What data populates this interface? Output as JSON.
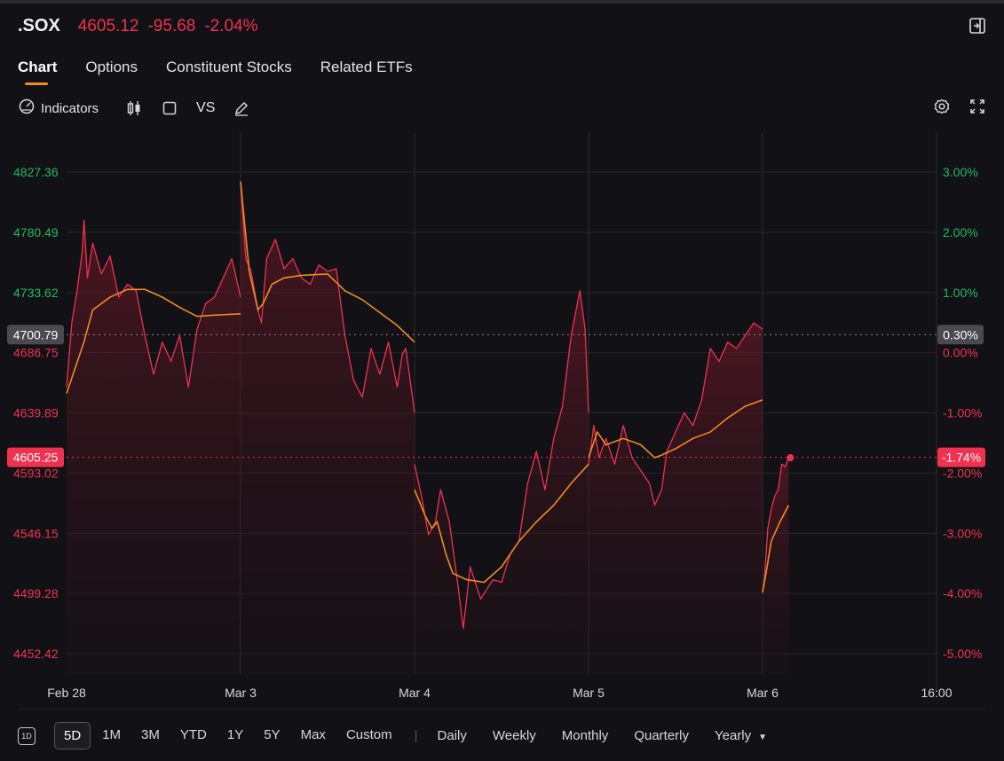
{
  "header": {
    "symbol": ".SOX",
    "price": "4605.12",
    "change": "-95.68",
    "change_pct": "-2.04%"
  },
  "tabs": [
    {
      "label": "Chart",
      "active": true
    },
    {
      "label": "Options"
    },
    {
      "label": "Constituent Stocks"
    },
    {
      "label": "Related ETFs"
    }
  ],
  "toolbar": {
    "indicators_label": "Indicators",
    "vs_label": "VS"
  },
  "icons": {
    "collapse": "collapse-panel-icon",
    "indicators": "gauge-icon",
    "candles": "candlestick-icon",
    "square": "square-icon",
    "draw": "pencil-icon",
    "settings": "gear-icon",
    "fullscreen": "expand-icon"
  },
  "colors": {
    "down": "#f0314f",
    "up": "#22b865",
    "avg_line": "#f08a24",
    "background": "#121216"
  },
  "chart_data": {
    "type": "line",
    "title": "",
    "xlabel": "",
    "ylabel": "",
    "x_tick_labels": [
      "Feb 28",
      "Mar 3",
      "Mar 4",
      "Mar 5",
      "Mar 6",
      "16:00"
    ],
    "y_left_ticks": [
      "4827.36",
      "4780.49",
      "4733.62",
      "4686.75",
      "4639.89",
      "4593.02",
      "4546.15",
      "4499.28",
      "4452.42"
    ],
    "y_left_up_ticks": [
      "4827.36",
      "4780.49",
      "4733.62"
    ],
    "y_right_ticks": [
      "3.00%",
      "2.00%",
      "1.00%",
      "0.00%",
      "-1.00%",
      "-2.00%",
      "-3.00%",
      "-4.00%",
      "-5.00%"
    ],
    "ylim": [
      4452.42,
      4827.36
    ],
    "prev_close": 4686.75,
    "ref_line": {
      "left_label": "4700.79",
      "right_label": "0.30%",
      "value": 4700.79
    },
    "last_line": {
      "left_label": "4605.25",
      "right_label": "-1.74%",
      "value": 4605.25
    },
    "grid": true,
    "series": [
      {
        "type": "price",
        "sessions": [
          {
            "day": "Feb 28",
            "points": [
              [
                0,
                4660
              ],
              [
                0.03,
                4710
              ],
              [
                0.06,
                4735
              ],
              [
                0.09,
                4765
              ],
              [
                0.1,
                4790
              ],
              [
                0.12,
                4745
              ],
              [
                0.15,
                4772
              ],
              [
                0.2,
                4748
              ],
              [
                0.25,
                4762
              ],
              [
                0.3,
                4730
              ],
              [
                0.35,
                4740
              ],
              [
                0.4,
                4735
              ],
              [
                0.45,
                4700
              ],
              [
                0.5,
                4670
              ],
              [
                0.55,
                4695
              ],
              [
                0.6,
                4680
              ],
              [
                0.65,
                4700
              ],
              [
                0.7,
                4660
              ],
              [
                0.75,
                4705
              ],
              [
                0.8,
                4725
              ],
              [
                0.85,
                4730
              ],
              [
                0.9,
                4745
              ],
              [
                0.95,
                4760
              ],
              [
                1,
                4730
              ]
            ]
          },
          {
            "day": "Mar 3",
            "points": [
              [
                0,
                4820
              ],
              [
                0.03,
                4760
              ],
              [
                0.06,
                4750
              ],
              [
                0.1,
                4720
              ],
              [
                0.12,
                4710
              ],
              [
                0.15,
                4760
              ],
              [
                0.2,
                4775
              ],
              [
                0.25,
                4752
              ],
              [
                0.3,
                4760
              ],
              [
                0.35,
                4745
              ],
              [
                0.4,
                4740
              ],
              [
                0.45,
                4755
              ],
              [
                0.5,
                4750
              ],
              [
                0.55,
                4752
              ],
              [
                0.6,
                4700
              ],
              [
                0.65,
                4665
              ],
              [
                0.7,
                4652
              ],
              [
                0.75,
                4690
              ],
              [
                0.8,
                4670
              ],
              [
                0.85,
                4695
              ],
              [
                0.9,
                4660
              ],
              [
                0.93,
                4686
              ],
              [
                0.95,
                4690
              ],
              [
                1,
                4640
              ]
            ]
          },
          {
            "day": "Mar 4",
            "points": [
              [
                0,
                4600
              ],
              [
                0.04,
                4575
              ],
              [
                0.08,
                4545
              ],
              [
                0.12,
                4555
              ],
              [
                0.15,
                4580
              ],
              [
                0.2,
                4555
              ],
              [
                0.25,
                4505
              ],
              [
                0.28,
                4472
              ],
              [
                0.32,
                4520
              ],
              [
                0.38,
                4495
              ],
              [
                0.45,
                4510
              ],
              [
                0.5,
                4508
              ],
              [
                0.55,
                4530
              ],
              [
                0.6,
                4540
              ],
              [
                0.65,
                4585
              ],
              [
                0.7,
                4610
              ],
              [
                0.75,
                4580
              ],
              [
                0.8,
                4620
              ],
              [
                0.85,
                4645
              ],
              [
                0.9,
                4700
              ],
              [
                0.95,
                4735
              ],
              [
                0.98,
                4705
              ],
              [
                1,
                4640
              ]
            ]
          },
          {
            "day": "Mar 5",
            "points": [
              [
                0,
                4600
              ],
              [
                0.03,
                4630
              ],
              [
                0.06,
                4605
              ],
              [
                0.1,
                4620
              ],
              [
                0.15,
                4600
              ],
              [
                0.2,
                4630
              ],
              [
                0.25,
                4605
              ],
              [
                0.3,
                4595
              ],
              [
                0.35,
                4585
              ],
              [
                0.38,
                4568
              ],
              [
                0.42,
                4580
              ],
              [
                0.45,
                4610
              ],
              [
                0.5,
                4625
              ],
              [
                0.55,
                4640
              ],
              [
                0.6,
                4630
              ],
              [
                0.65,
                4650
              ],
              [
                0.7,
                4690
              ],
              [
                0.75,
                4680
              ],
              [
                0.8,
                4695
              ],
              [
                0.85,
                4690
              ],
              [
                0.9,
                4700
              ],
              [
                0.95,
                4710
              ],
              [
                1,
                4705
              ]
            ]
          },
          {
            "day": "Mar 6",
            "points": [
              [
                0,
                4500
              ],
              [
                0.01,
                4510
              ],
              [
                0.03,
                4550
              ],
              [
                0.05,
                4565
              ],
              [
                0.07,
                4575
              ],
              [
                0.09,
                4580
              ],
              [
                0.11,
                4600
              ],
              [
                0.13,
                4598
              ],
              [
                0.15,
                4605
              ]
            ]
          }
        ]
      },
      {
        "type": "average",
        "sessions": [
          {
            "day": "Feb 28",
            "points": [
              [
                0,
                4655
              ],
              [
                0.1,
                4695
              ],
              [
                0.15,
                4720
              ],
              [
                0.25,
                4730
              ],
              [
                0.35,
                4736
              ],
              [
                0.45,
                4736
              ],
              [
                0.55,
                4730
              ],
              [
                0.65,
                4722
              ],
              [
                0.75,
                4715
              ],
              [
                0.85,
                4716
              ],
              [
                1,
                4717
              ]
            ]
          },
          {
            "day": "Mar 3",
            "points": [
              [
                0,
                4820
              ],
              [
                0.05,
                4750
              ],
              [
                0.1,
                4720
              ],
              [
                0.13,
                4725
              ],
              [
                0.18,
                4740
              ],
              [
                0.25,
                4745
              ],
              [
                0.35,
                4747
              ],
              [
                0.5,
                4748
              ],
              [
                0.6,
                4735
              ],
              [
                0.7,
                4728
              ],
              [
                0.8,
                4718
              ],
              [
                0.9,
                4708
              ],
              [
                1,
                4695
              ]
            ]
          },
          {
            "day": "Mar 4",
            "points": [
              [
                0,
                4580
              ],
              [
                0.06,
                4560
              ],
              [
                0.1,
                4550
              ],
              [
                0.13,
                4555
              ],
              [
                0.18,
                4530
              ],
              [
                0.22,
                4515
              ],
              [
                0.3,
                4510
              ],
              [
                0.4,
                4508
              ],
              [
                0.5,
                4520
              ],
              [
                0.6,
                4540
              ],
              [
                0.7,
                4555
              ],
              [
                0.8,
                4568
              ],
              [
                0.9,
                4585
              ],
              [
                1,
                4600
              ]
            ]
          },
          {
            "day": "Mar 5",
            "points": [
              [
                0,
                4605
              ],
              [
                0.05,
                4625
              ],
              [
                0.1,
                4615
              ],
              [
                0.2,
                4620
              ],
              [
                0.3,
                4615
              ],
              [
                0.38,
                4605
              ],
              [
                0.42,
                4607
              ],
              [
                0.5,
                4612
              ],
              [
                0.6,
                4620
              ],
              [
                0.7,
                4625
              ],
              [
                0.8,
                4636
              ],
              [
                0.9,
                4645
              ],
              [
                1,
                4650
              ]
            ]
          },
          {
            "day": "Mar 6",
            "points": [
              [
                0,
                4500
              ],
              [
                0.02,
                4515
              ],
              [
                0.05,
                4540
              ],
              [
                0.1,
                4555
              ],
              [
                0.15,
                4568
              ]
            ]
          }
        ]
      }
    ]
  },
  "bottom_bar": {
    "one_d_label": "1D",
    "ranges": [
      "5D",
      "1M",
      "3M",
      "YTD",
      "1Y",
      "5Y",
      "Max",
      "Custom"
    ],
    "active_range": "5D",
    "separator": "|",
    "periods": [
      "Daily",
      "Weekly",
      "Monthly",
      "Quarterly",
      "Yearly"
    ]
  }
}
